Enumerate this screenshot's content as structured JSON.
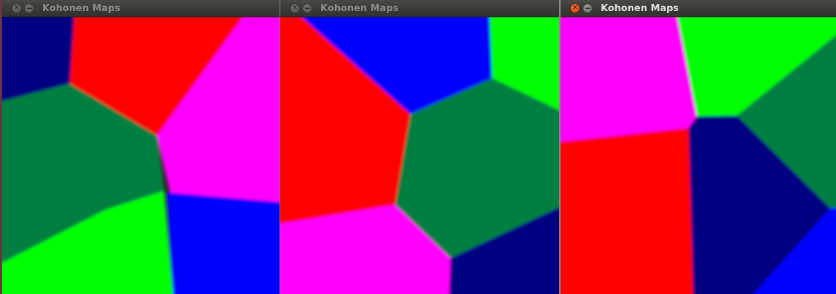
{
  "windows": [
    {
      "title": "Kohonen Maps",
      "state": "inactive",
      "controls": [
        {
          "name": "close",
          "icon": "close-icon"
        },
        {
          "name": "minimize",
          "icon": "minimize-icon"
        }
      ],
      "map_colors": [
        "#000080",
        "#ff0000",
        "#007f3f",
        "#ff00ff",
        "#00ff00",
        "#0000ff"
      ]
    },
    {
      "title": "Kohonen Maps",
      "state": "inactive",
      "controls": [
        {
          "name": "close",
          "icon": "close-icon"
        },
        {
          "name": "minimize",
          "icon": "minimize-icon"
        }
      ],
      "map_colors": [
        "#0000ff",
        "#00ff00",
        "#ff0000",
        "#007f3f",
        "#ff00ff",
        "#000080"
      ]
    },
    {
      "title": "Kohonen Maps",
      "state": "active",
      "controls": [
        {
          "name": "close",
          "icon": "close-icon"
        },
        {
          "name": "minimize",
          "icon": "minimize-icon"
        }
      ],
      "map_colors": [
        "#ff00ff",
        "#00ff00",
        "#007f3f",
        "#ff0000",
        "#000080",
        "#0000ff"
      ]
    }
  ]
}
